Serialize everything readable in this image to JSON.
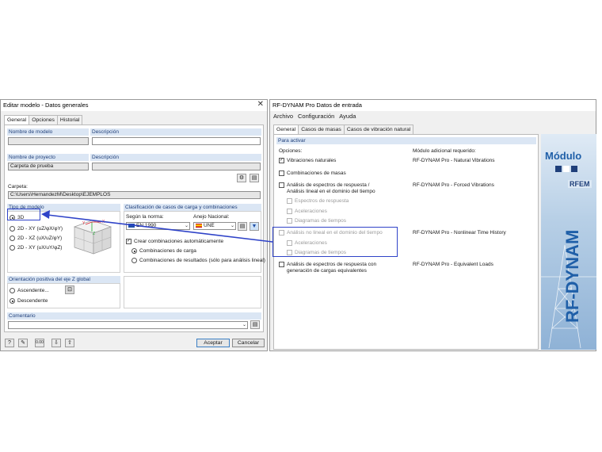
{
  "left_dialog": {
    "title": "Editar modelo - Datos generales",
    "tabs": [
      "General",
      "Opciones",
      "Historial"
    ],
    "model_name_label": "Nombre de modelo",
    "model_desc_label": "Descripción",
    "model_name_value": "",
    "model_desc_value": "",
    "project_name_label": "Nombre de proyecto",
    "project_desc_label": "Descripción",
    "project_name_value": "Carpeta de prueba",
    "project_desc_value": "",
    "folder_label": "Carpeta:",
    "folder_value": "C:\\Users\\HernandezM\\Desktop\\EJEMPLOS",
    "model_type": {
      "label": "Tipo de modelo",
      "options": [
        "3D",
        "2D - XY (uZ/φX/φY)",
        "2D - XZ (uX/uZ/φY)",
        "2D - XY (uX/uY/φZ)"
      ],
      "selected": 0
    },
    "classification": {
      "label": "Clasificación de casos de carga y combinaciones",
      "norm_label": "Según la norma:",
      "norm_value": "EN 1990",
      "annex_label": "Anejo Nacional:",
      "annex_value": "UNE",
      "create_combos_label": "Crear combinaciones automáticamente",
      "option1": "Combinaciones de carga",
      "option2": "Combinaciones de resultados (sólo para análisis lineal)"
    },
    "z_axis": {
      "label": "Orientación positiva del eje Z global",
      "option1": "Ascendente...",
      "option2": "Descendente"
    },
    "comment_label": "Comentario",
    "comment_value": "",
    "accept_label": "Aceptar",
    "cancel_label": "Cancelar"
  },
  "right_dialog": {
    "title": "RF-DYNAM Pro Datos de entrada",
    "menu": [
      "Archivo",
      "Configuración",
      "Ayuda"
    ],
    "tabs": [
      "General",
      "Casos de masas",
      "Casos de vibración natural"
    ],
    "group_label": "Para activar",
    "options_header": "Opciones:",
    "module_header": "Módulo adicional requerido:",
    "items": [
      {
        "label": "Vibraciones naturales",
        "checked": true,
        "disabled": false,
        "module": "RF-DYNAM Pro - Natural Vibrations"
      },
      {
        "label": "Combinaciones de masas",
        "checked": false,
        "disabled": false,
        "module": ""
      },
      {
        "label": "Análisis de espectros de respuesta /",
        "label2": "Análisis lineal en el dominio del tiempo",
        "checked": false,
        "disabled": false,
        "module": "RF-DYNAM Pro - Forced Vibrations"
      },
      {
        "label": "Espectros de respuesta",
        "checked": false,
        "disabled": true,
        "module": ""
      },
      {
        "label": "Aceleraciones",
        "checked": false,
        "disabled": true,
        "module": ""
      },
      {
        "label": "Diagramas de tiempos",
        "checked": false,
        "disabled": true,
        "module": ""
      },
      {
        "label": "Análisis no lineal en el dominio del tiempo",
        "checked": false,
        "disabled": true,
        "module": "RF-DYNAM Pro - Nonlinear Time History"
      },
      {
        "label": "Aceleraciones",
        "checked": false,
        "disabled": true,
        "module": ""
      },
      {
        "label": "Diagramas de tiempos",
        "checked": false,
        "disabled": true,
        "module": ""
      },
      {
        "label": "Análisis de espectros de respuesta con",
        "label2": "generación de cargas equivalentes",
        "checked": false,
        "disabled": false,
        "module": "RF-DYNAM Pro - Equivalent Loads"
      }
    ],
    "banner": {
      "module_text": "Módulo",
      "rfem_text": "RFEM",
      "product_text": "RF-DYNAM"
    }
  },
  "colors": {
    "highlight": "#2f43c8",
    "group_header": "#dbe6f4",
    "banner_blue": "#1f5fa8"
  }
}
